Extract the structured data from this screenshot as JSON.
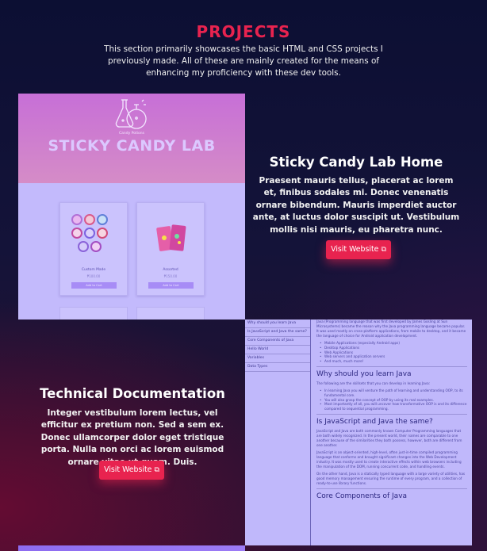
{
  "section": {
    "title": "PROJECTS",
    "intro": "This section primarily showcases the basic HTML and CSS projects I previously made. All of these are mainly created for the means of enhancing my proficiency with these dev tools."
  },
  "projects": [
    {
      "title": "Sticky Candy Lab Home",
      "description": "Praesent mauris tellus, placerat ac lorem et, finibus sodales mi. Donec venenatis ornare bibendum. Mauris imperdiet auctor ante, at luctus dolor suscipit ut. Vestibulum mollis nisi mauris, eu pharetra nunc.",
      "button_label": "Visit Website",
      "screenshot": {
        "brand_small": "Candy Potions",
        "brand_title": "STICKY CANDY LAB",
        "cards": [
          {
            "label": "Custom Made",
            "price": "₱100.00",
            "button": "Add to Cart"
          },
          {
            "label": "Assorted",
            "price": "₱150.00",
            "button": "Add to Cart"
          }
        ]
      }
    },
    {
      "title": "Technical Documentation",
      "description": "Integer vestibulum lorem lectus, vel efficitur ex pretium non. Sed a sem ex. Donec ullamcorper dolor eget tristique porta. Nulla non orci ac lorem euismod ornare vitae ut quam. Duis.",
      "button_label": "Visit Website",
      "screenshot": {
        "nav": [
          "Why should you learn Java",
          "Is JavaScript and Java the same?",
          "Core Components of Java",
          "Hello World",
          "Variables",
          "Data Types"
        ],
        "intro_text": "Java (Programming language that was first developed by James Gosling at Sun Microsystems) became the reason why the Java programming language became popular. It was used mostly on cross-platform applications, from mobile to desktop, and it became the language of choice for Android application development.",
        "intro_list": [
          "Mobile Applications (especially Android apps)",
          "Desktop Applications",
          "Web Applications",
          "Web servers and application servers",
          "And much, much more!"
        ],
        "h1": "Why should you learn Java",
        "p1": "The following are the skillsets that you can develop in learning Java:",
        "list1": [
          "In learning Java you will venture the path of learning and understanding OOP, to its fundamental core.",
          "You will also grasp the concept of OOP by using its real examples.",
          "Most importantly of all, you will uncover how transformative OOP is and its difference compared to sequential programming."
        ],
        "h2": "Is JavaScript and Java the same?",
        "p2": "JavaScript and Java are both commonly known Computer Programming languages that are both widely recognized. In the present world, their names are comparable to one another because of the similarities they both possess, however, both are different from one another.",
        "p3": "JavaScript is an object-oriented, high-level, often just-in-time compiled programming language that conforms and brought significant changes into the Web Development industry. It was mostly used to create interactive effects within web browsers including the manipulation of the DOM, running concurrent code, and handling events.",
        "p4": "On the other hand, Java is a statically typed language with a large variety of utilities, has good memory management ensuring the runtime of every program, and a collection of ready-to-use library functions.",
        "h3": "Core Components of Java"
      }
    }
  ],
  "colors": {
    "accent": "#e8234f",
    "background": "#141339"
  },
  "icons": {
    "external_link": "external-link-icon",
    "flask": "flask-icon"
  }
}
